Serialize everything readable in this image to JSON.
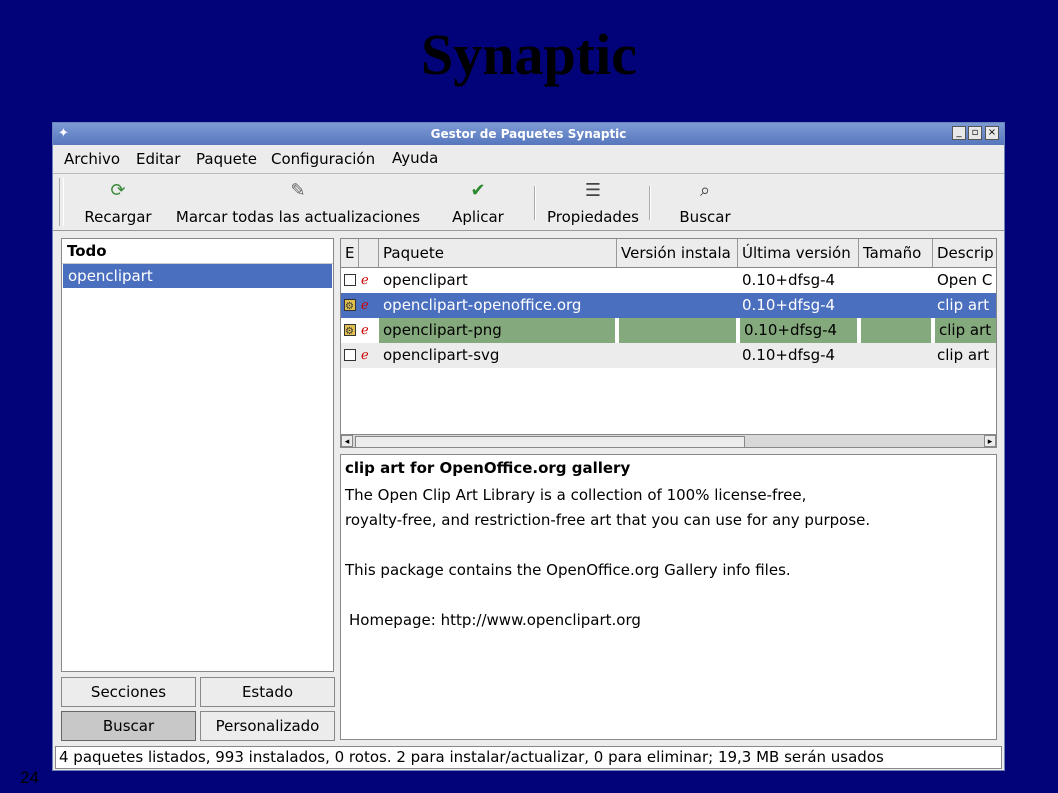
{
  "slide": {
    "title": "Synaptic",
    "page_number": "24"
  },
  "window": {
    "title": "Gestor de Paquetes Synaptic",
    "controls": {
      "minimize": "_",
      "maximize": "▫",
      "close": "×"
    }
  },
  "menubar": [
    "Archivo",
    "Editar",
    "Paquete",
    "Configuración",
    "Ayuda"
  ],
  "toolbar": {
    "reload": {
      "label": "Recargar",
      "icon": "reload-icon"
    },
    "mark_all": {
      "label": "Marcar todas las actualizaciones",
      "icon": "mark-upgrades-icon"
    },
    "apply": {
      "label": "Aplicar",
      "icon": "apply-check-icon"
    },
    "properties": {
      "label": "Propiedades",
      "icon": "properties-icon"
    },
    "search": {
      "label": "Buscar",
      "icon": "search-icon"
    }
  },
  "sidebar": {
    "header": "Todo",
    "items": [
      "openclipart"
    ]
  },
  "filter_buttons": {
    "sections": "Secciones",
    "status": "Estado",
    "search": "Buscar",
    "custom": "Personalizado"
  },
  "packages": {
    "columns": [
      "E",
      "",
      "Paquete",
      "Versión instala",
      "Última versión",
      "Tamaño",
      "Descrip"
    ],
    "rows": [
      {
        "name": "openclipart",
        "installed": "",
        "latest": "0.10+dfsg-4",
        "size": "",
        "desc": "Open C",
        "state": "none",
        "highlight": "none"
      },
      {
        "name": "openclipart-openoffice.org",
        "installed": "",
        "latest": "0.10+dfsg-4",
        "size": "",
        "desc": "clip art",
        "state": "install",
        "highlight": "selected"
      },
      {
        "name": "openclipart-png",
        "installed": "",
        "latest": "0.10+dfsg-4",
        "size": "",
        "desc": "clip art",
        "state": "install",
        "highlight": "marked"
      },
      {
        "name": "openclipart-svg",
        "installed": "",
        "latest": "0.10+dfsg-4",
        "size": "",
        "desc": "clip art",
        "state": "none",
        "highlight": "none"
      }
    ]
  },
  "description": {
    "heading": "clip art for OpenOffice.org gallery",
    "line1": "The Open Clip Art Library is a collection of 100% license-free,",
    "line2": "royalty-free, and restriction-free art that you can use for any purpose.",
    "line3": "This package contains the OpenOffice.org Gallery info files.",
    "homepage": "Homepage: http://www.openclipart.org"
  },
  "status": "4 paquetes listados, 993 instalados, 0 rotos. 2 para instalar/actualizar, 0 para eliminar; 19,3 MB serán usados",
  "colors": {
    "selection": "#4b6fbf",
    "marked": "#84a97c",
    "slide_background": "#020279"
  }
}
